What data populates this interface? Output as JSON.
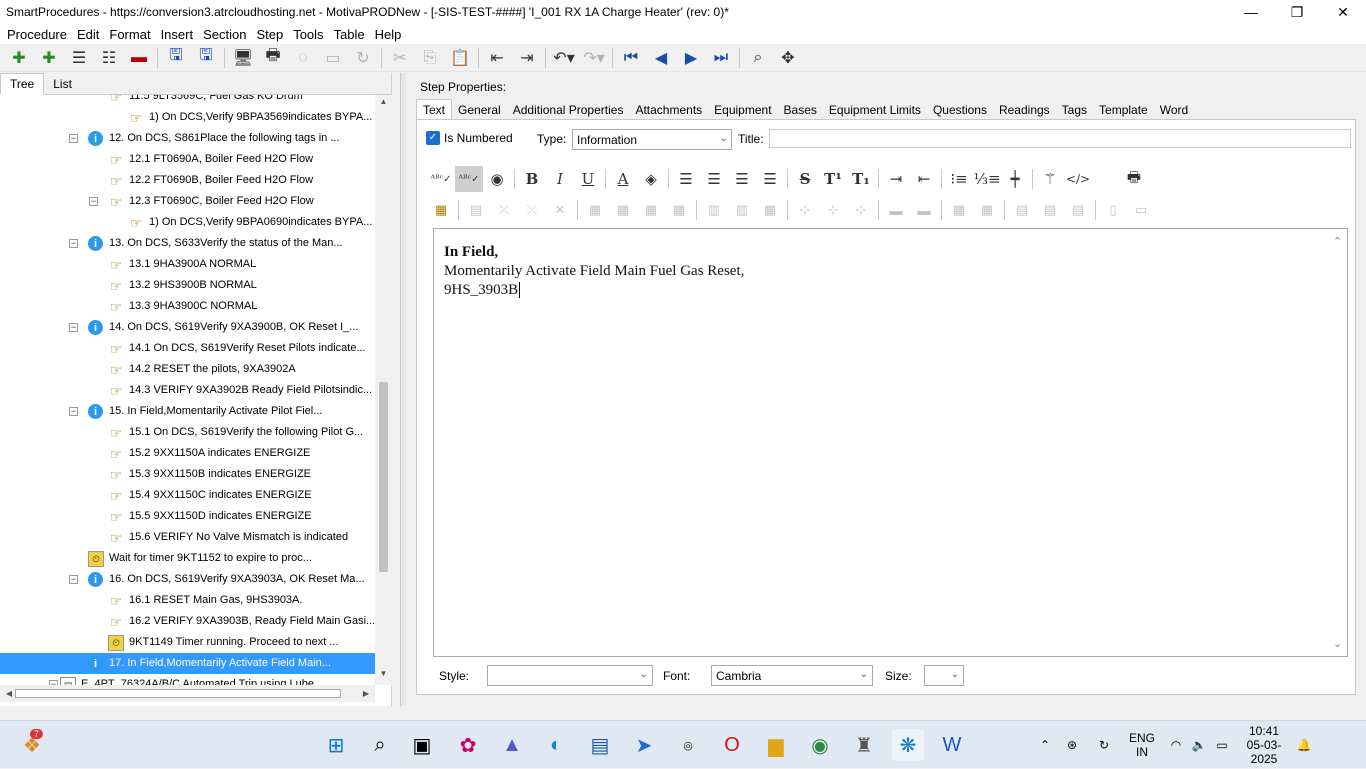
{
  "window": {
    "title": "SmartProcedures - https://conversion3.atrcloudhosting.net - MotivaPRODNew - [-SIS-TEST-####] 'I_001 RX 1A Charge Heater' (rev: 0)*",
    "minimize": "—",
    "maximize": "❐",
    "close": "✕"
  },
  "menu": [
    "Procedure",
    "Edit",
    "Format",
    "Insert",
    "Section",
    "Step",
    "Tools",
    "Table",
    "Help"
  ],
  "left_tabs": [
    "Tree",
    "List"
  ],
  "tree": [
    {
      "label": "11.5 9LT3569C, Fuel Gas KO Drum",
      "icon": "hand",
      "level": 2
    },
    {
      "label": "1) On DCS,Verify  9BPA3569indicates  BYPA...",
      "icon": "hand",
      "level": 3
    },
    {
      "label": "12. On DCS, S861Place the following tags in ...",
      "icon": "info",
      "level": 1,
      "expander": "−"
    },
    {
      "label": "12.1 FT0690A, Boiler Feed H2O Flow",
      "icon": "hand",
      "level": 2
    },
    {
      "label": "12.2 FT0690B, Boiler Feed H2O Flow",
      "icon": "hand",
      "level": 2
    },
    {
      "label": "12.3 FT0690C, Boiler Feed H2O Flow",
      "icon": "hand",
      "level": 2,
      "expander": "−"
    },
    {
      "label": "1) On DCS,Verify  9BPA0690indicates  BYPA...",
      "icon": "hand",
      "level": 3
    },
    {
      "label": "13. On DCS, S633Verify the status of the Man...",
      "icon": "info",
      "level": 1,
      "expander": "−"
    },
    {
      "label": "13.1 9HA3900A      NORMAL",
      "icon": "hand",
      "level": 2
    },
    {
      "label": "13.2 9HS3900B      NORMAL",
      "icon": "hand",
      "level": 2
    },
    {
      "label": "13.3 9HA3900C      NORMAL",
      "icon": "hand",
      "level": 2
    },
    {
      "label": "14. On DCS, S619Verify 9XA3900B, OK Reset I_...",
      "icon": "info",
      "level": 1,
      "expander": "−"
    },
    {
      "label": "14.1 On DCS, S619Verify Reset Pilots indicate...",
      "icon": "hand",
      "level": 2
    },
    {
      "label": "14.2 RESET the pilots, 9XA3902A",
      "icon": "hand",
      "level": 2
    },
    {
      "label": "14.3 VERIFY  9XA3902B  Ready  Field  Pilotsindic...",
      "icon": "hand",
      "level": 2
    },
    {
      "label": "15. In Field,Momentarily Activate Pilot Fiel...",
      "icon": "info",
      "level": 1,
      "expander": "−"
    },
    {
      "label": "15.1 On DCS, S619Verify the following Pilot G...",
      "icon": "hand",
      "level": 2
    },
    {
      "label": "15.2 9XX1150A indicates ENERGIZE",
      "icon": "hand",
      "level": 2
    },
    {
      "label": "15.3 9XX1150B indicates ENERGIZE",
      "icon": "hand",
      "level": 2
    },
    {
      "label": "15.4 9XX1150C indicates ENERGIZE",
      "icon": "hand",
      "level": 2
    },
    {
      "label": "15.5 9XX1150D indicates ENERGIZE",
      "icon": "hand",
      "level": 2
    },
    {
      "label": "15.6 VERIFY No Valve Mismatch is indicated",
      "icon": "hand",
      "level": 2
    },
    {
      "label": "Wait for timer 9KT1152 to expire to proc...",
      "icon": "timer",
      "level": 1
    },
    {
      "label": "16. On DCS, S619Verify 9XA3903A, OK Reset Ma...",
      "icon": "info",
      "level": 1,
      "expander": "−"
    },
    {
      "label": "16.1 RESET Main Gas, 9HS3903A.",
      "icon": "hand",
      "level": 2
    },
    {
      "label": "16.2  VERIFY  9XA3903B,  Ready  Field  Main  Gasi...",
      "icon": "hand",
      "level": 2
    },
    {
      "label": "9KT1149 Timer running.  Proceed to next ...",
      "icon": "timer",
      "level": 2
    },
    {
      "label": "17. In Field,Momentarily Activate Field Main...",
      "icon": "info",
      "level": 1,
      "selected": true
    },
    {
      "label": "E. 4PT_76324A/B/C  Automated Trip using Lube...",
      "icon": "doc",
      "level": 0,
      "expander": "−"
    }
  ],
  "step_properties": {
    "heading": "Step Properties:",
    "tabs": [
      "Text",
      "General",
      "Additional Properties",
      "Attachments",
      "Equipment",
      "Bases",
      "Equipment Limits",
      "Questions",
      "Readings",
      "Tags",
      "Template",
      "Word"
    ],
    "is_numbered_label": "Is Numbered",
    "is_numbered_checked": true,
    "type_label": "Type:",
    "type_value": "Information",
    "title_label": "Title:",
    "title_value": ""
  },
  "editor": {
    "line1": "In Field,",
    "line2": "Momentarily Activate Field Main Fuel Gas Reset,",
    "line3": "9HS_3903B"
  },
  "bottom": {
    "style_label": "Style:",
    "style_value": "",
    "font_label": "Font:",
    "font_value": "Cambria",
    "size_label": "Size:",
    "size_value": ""
  },
  "taskbar": {
    "notification_count": "7",
    "lang": "ENG",
    "region": "IN",
    "time": "10:41",
    "date": "05-03-2025"
  }
}
